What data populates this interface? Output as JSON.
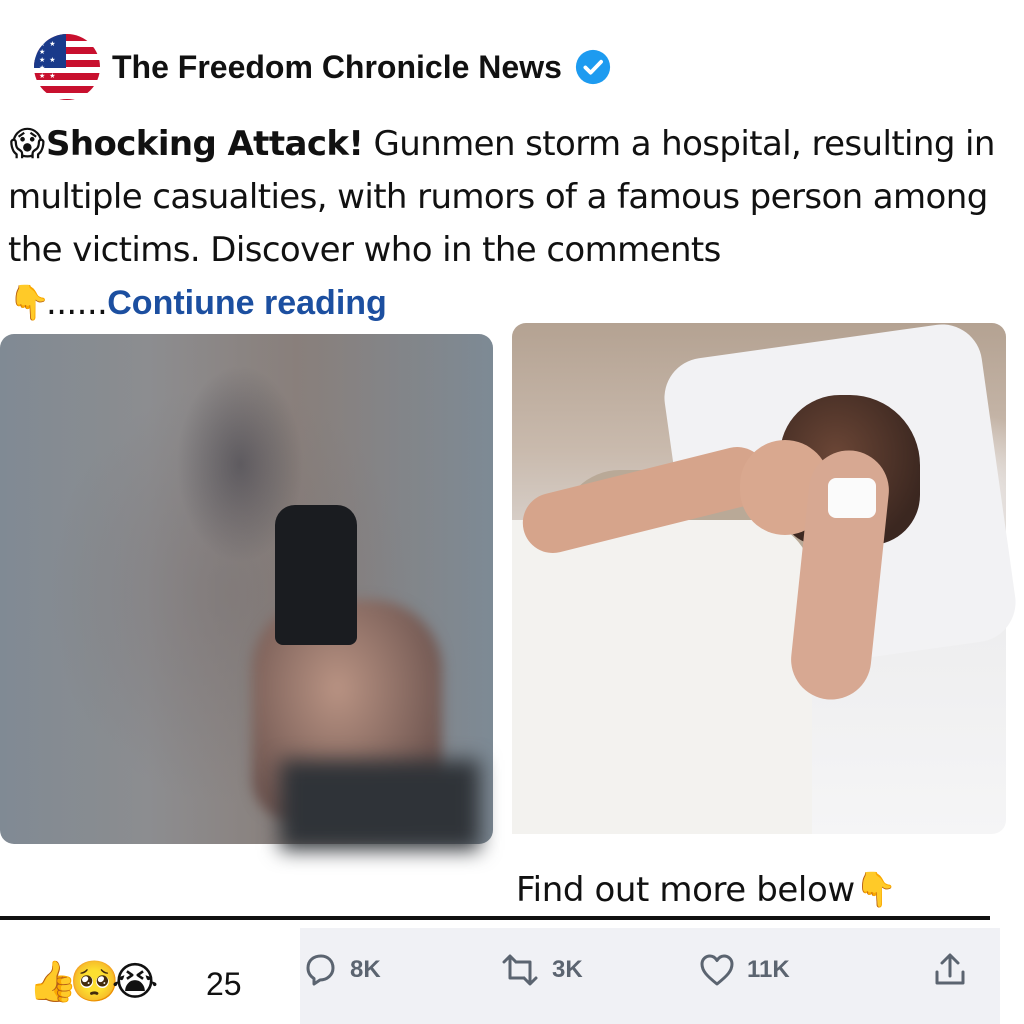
{
  "account": {
    "name": "The Freedom Chronicle News",
    "avatar_icon": "us-flag-icon",
    "verified_icon": "verified-badge-icon",
    "verified_color": "#1d9bf0"
  },
  "post": {
    "lead_emoji": "😱",
    "headline": "Shocking Attack!",
    "body": " Gunmen storm a hospital, resulting in multiple casualties, with rumors of a famous person among the victims. Discover who in the comments",
    "pointer_emoji": "👇",
    "ellipsis": "......",
    "continue_label": "Contiune reading",
    "link_color": "#1c4fa0"
  },
  "images": [
    {
      "icon": "blurred-handgun-photo"
    },
    {
      "icon": "woman-in-hospital-bed-photo"
    }
  ],
  "cta": {
    "text": "Find out more below",
    "emoji": "👇"
  },
  "reactions": {
    "emojis": [
      "👍",
      "🥺",
      "😭"
    ],
    "count": "25"
  },
  "actions": {
    "reply": {
      "icon": "reply-icon",
      "count": "8K"
    },
    "retweet": {
      "icon": "retweet-icon",
      "count": "3K"
    },
    "like": {
      "icon": "heart-icon",
      "count": "11K"
    },
    "share": {
      "icon": "share-icon"
    }
  }
}
